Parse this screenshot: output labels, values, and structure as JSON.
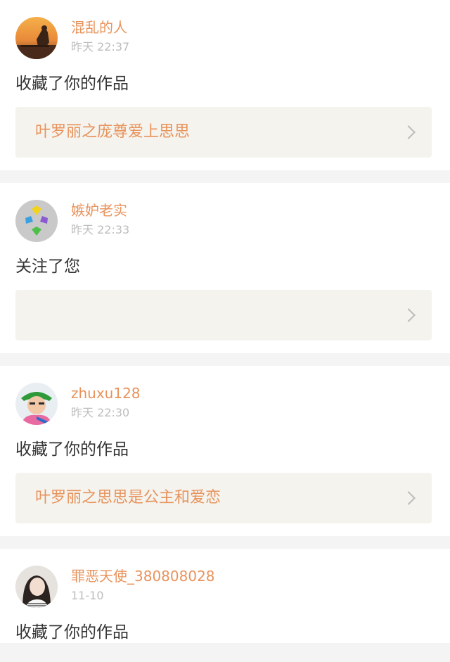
{
  "notifications": [
    {
      "username": "混乱的人",
      "time": "昨天 22:37",
      "action": "收藏了你的作品",
      "work_title": "叶罗丽之庞尊爱上思思",
      "avatar_icon": "sunset-person-avatar"
    },
    {
      "username": "嫉妒老实",
      "time": "昨天 22:33",
      "action": "关注了您",
      "work_title": "",
      "avatar_icon": "colorful-hearts-avatar"
    },
    {
      "username": "zhuxu128",
      "time": "昨天 22:30",
      "action": "收藏了你的作品",
      "work_title": "叶罗丽之思思是公主和爱恋",
      "avatar_icon": "person-green-cap-avatar"
    },
    {
      "username": "罪恶天使_380808028",
      "time": "11-10",
      "action": "收藏了你的作品",
      "avatar_icon": "girl-portrait-avatar"
    }
  ],
  "colors": {
    "accent": "#e8935c",
    "time_text": "#bdbdbd",
    "body_text": "#333333",
    "link_bg": "#f4f3ee",
    "separator": "#f4f4f4"
  },
  "icons": {
    "link_chevron": "chevron-right-icon"
  }
}
